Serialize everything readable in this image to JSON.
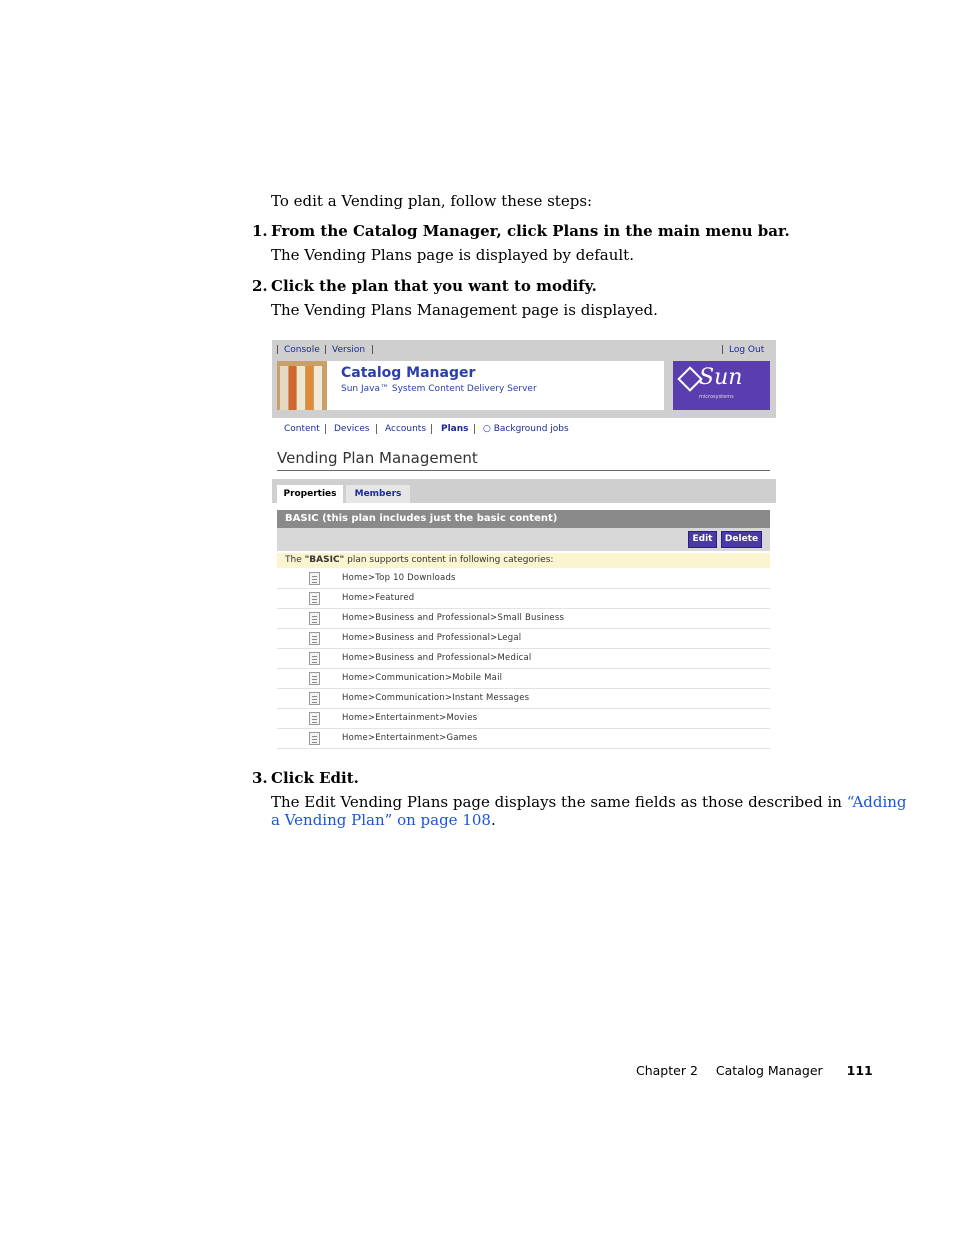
{
  "intro": "To edit a Vending plan, follow these steps:",
  "steps": [
    {
      "num": "1.",
      "heading": "From the Catalog Manager, click Plans in the main menu bar.",
      "body": "The Vending Plans page is displayed by default."
    },
    {
      "num": "2.",
      "heading": "Click the plan that you want to modify.",
      "body": "The Vending Plans Management page is displayed."
    },
    {
      "num": "3.",
      "heading": "Click Edit.",
      "body_line1_text": "The Edit Vending Plans page displays the same fields as those described in ",
      "body_line1_link": "“Adding",
      "body_line2_link": "a Vending Plan” on page 108",
      "body_line2_end": "."
    }
  ],
  "screenshot": {
    "top_links": {
      "console": "Console",
      "version": "Version",
      "logout": "Log Out"
    },
    "brand": {
      "title": "Catalog Manager",
      "subtitle": "Sun Java™ System Content Delivery Server"
    },
    "logo": {
      "word": "Sun",
      "small": "microsystems"
    },
    "nav": {
      "content": "Content",
      "devices": "Devices",
      "accounts": "Accounts",
      "plans": "Plans",
      "background": "Background jobs"
    },
    "page_heading": "Vending Plan Management",
    "tabs": {
      "properties": "Properties",
      "members": "Members"
    },
    "plan_title": "BASIC (this plan includes just the basic content)",
    "buttons": {
      "edit": "Edit",
      "delete": "Delete"
    },
    "info": {
      "prefix": "The ",
      "plan": "\"BASIC\"",
      "suffix": " plan supports content in following categories:"
    },
    "categories": [
      "Home>Top 10 Downloads",
      "Home>Featured",
      "Home>Business and Professional>Small Business",
      "Home>Business and Professional>Legal",
      "Home>Business and Professional>Medical",
      "Home>Communication>Mobile Mail",
      "Home>Communication>Instant Messages",
      "Home>Entertainment>Movies",
      "Home>Entertainment>Games"
    ]
  },
  "footer": {
    "chapter": "Chapter 2",
    "section": "Catalog Manager",
    "page": "111"
  }
}
